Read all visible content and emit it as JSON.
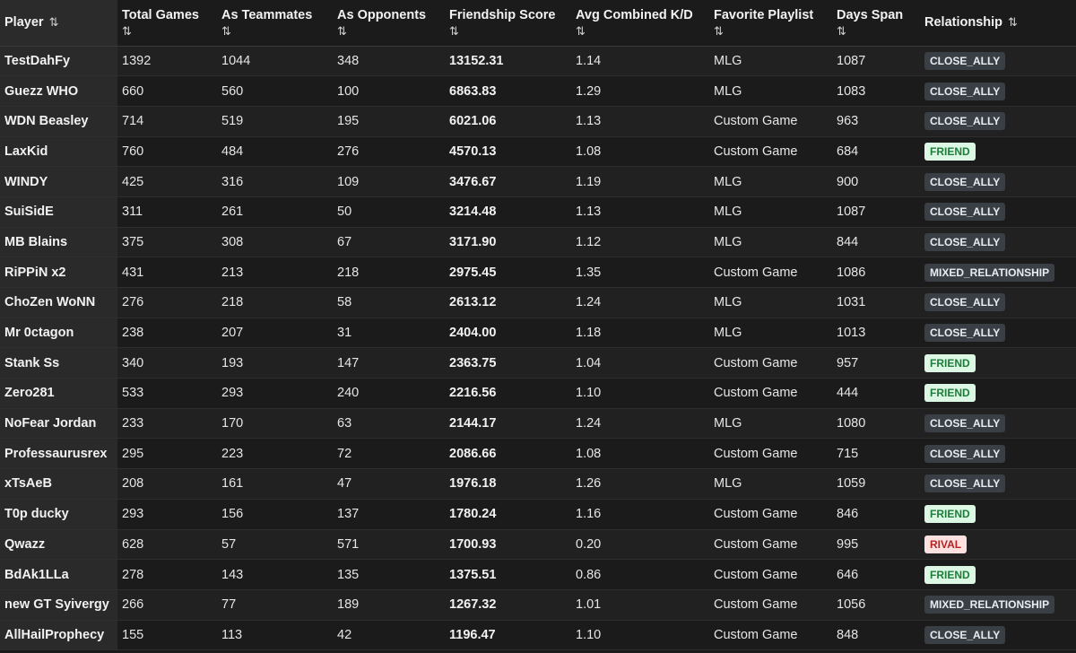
{
  "sort_icon": "⇅",
  "columns": [
    {
      "key": "player",
      "label": "Player"
    },
    {
      "key": "total",
      "label": "Total Games"
    },
    {
      "key": "teammates",
      "label": "As Teammates"
    },
    {
      "key": "opponents",
      "label": "As Opponents"
    },
    {
      "key": "score",
      "label": "Friendship Score"
    },
    {
      "key": "kd",
      "label": "Avg Combined K/D"
    },
    {
      "key": "playlist",
      "label": "Favorite Playlist"
    },
    {
      "key": "days",
      "label": "Days Span"
    },
    {
      "key": "relationship",
      "label": "Relationship"
    }
  ],
  "badge_colors": {
    "CLOSE_ALLY": "#3a3f45",
    "FRIEND": "#dcf7e3",
    "RIVAL": "#fde0e0",
    "MIXED_RELATIONSHIP": "#3a3f45"
  },
  "rows": [
    {
      "player": "TestDahFy",
      "total": "1392",
      "teammates": "1044",
      "opponents": "348",
      "score": "13152.31",
      "kd": "1.14",
      "playlist": "MLG",
      "days": "1087",
      "relationship": "CLOSE_ALLY"
    },
    {
      "player": "Guezz WHO",
      "total": "660",
      "teammates": "560",
      "opponents": "100",
      "score": "6863.83",
      "kd": "1.29",
      "playlist": "MLG",
      "days": "1083",
      "relationship": "CLOSE_ALLY"
    },
    {
      "player": "WDN Beasley",
      "total": "714",
      "teammates": "519",
      "opponents": "195",
      "score": "6021.06",
      "kd": "1.13",
      "playlist": "Custom Game",
      "days": "963",
      "relationship": "CLOSE_ALLY"
    },
    {
      "player": "LaxKid",
      "total": "760",
      "teammates": "484",
      "opponents": "276",
      "score": "4570.13",
      "kd": "1.08",
      "playlist": "Custom Game",
      "days": "684",
      "relationship": "FRIEND"
    },
    {
      "player": "WINDY",
      "total": "425",
      "teammates": "316",
      "opponents": "109",
      "score": "3476.67",
      "kd": "1.19",
      "playlist": "MLG",
      "days": "900",
      "relationship": "CLOSE_ALLY"
    },
    {
      "player": "SuiSidE",
      "total": "311",
      "teammates": "261",
      "opponents": "50",
      "score": "3214.48",
      "kd": "1.13",
      "playlist": "MLG",
      "days": "1087",
      "relationship": "CLOSE_ALLY"
    },
    {
      "player": "MB Blains",
      "total": "375",
      "teammates": "308",
      "opponents": "67",
      "score": "3171.90",
      "kd": "1.12",
      "playlist": "MLG",
      "days": "844",
      "relationship": "CLOSE_ALLY"
    },
    {
      "player": "RiPPiN x2",
      "total": "431",
      "teammates": "213",
      "opponents": "218",
      "score": "2975.45",
      "kd": "1.35",
      "playlist": "Custom Game",
      "days": "1086",
      "relationship": "MIXED_RELATIONSHIP"
    },
    {
      "player": "ChoZen WoNN",
      "total": "276",
      "teammates": "218",
      "opponents": "58",
      "score": "2613.12",
      "kd": "1.24",
      "playlist": "MLG",
      "days": "1031",
      "relationship": "CLOSE_ALLY"
    },
    {
      "player": "Mr 0ctagon",
      "total": "238",
      "teammates": "207",
      "opponents": "31",
      "score": "2404.00",
      "kd": "1.18",
      "playlist": "MLG",
      "days": "1013",
      "relationship": "CLOSE_ALLY"
    },
    {
      "player": "Stank Ss",
      "total": "340",
      "teammates": "193",
      "opponents": "147",
      "score": "2363.75",
      "kd": "1.04",
      "playlist": "Custom Game",
      "days": "957",
      "relationship": "FRIEND"
    },
    {
      "player": "Zero281",
      "total": "533",
      "teammates": "293",
      "opponents": "240",
      "score": "2216.56",
      "kd": "1.10",
      "playlist": "Custom Game",
      "days": "444",
      "relationship": "FRIEND"
    },
    {
      "player": "NoFear Jordan",
      "total": "233",
      "teammates": "170",
      "opponents": "63",
      "score": "2144.17",
      "kd": "1.24",
      "playlist": "MLG",
      "days": "1080",
      "relationship": "CLOSE_ALLY"
    },
    {
      "player": "Professaurusrex",
      "total": "295",
      "teammates": "223",
      "opponents": "72",
      "score": "2086.66",
      "kd": "1.08",
      "playlist": "Custom Game",
      "days": "715",
      "relationship": "CLOSE_ALLY"
    },
    {
      "player": "xTsAeB",
      "total": "208",
      "teammates": "161",
      "opponents": "47",
      "score": "1976.18",
      "kd": "1.26",
      "playlist": "MLG",
      "days": "1059",
      "relationship": "CLOSE_ALLY"
    },
    {
      "player": "T0p ducky",
      "total": "293",
      "teammates": "156",
      "opponents": "137",
      "score": "1780.24",
      "kd": "1.16",
      "playlist": "Custom Game",
      "days": "846",
      "relationship": "FRIEND"
    },
    {
      "player": "Qwazz",
      "total": "628",
      "teammates": "57",
      "opponents": "571",
      "score": "1700.93",
      "kd": "0.20",
      "playlist": "Custom Game",
      "days": "995",
      "relationship": "RIVAL"
    },
    {
      "player": "BdAk1LLa",
      "total": "278",
      "teammates": "143",
      "opponents": "135",
      "score": "1375.51",
      "kd": "0.86",
      "playlist": "Custom Game",
      "days": "646",
      "relationship": "FRIEND"
    },
    {
      "player": "new GT Syivergy",
      "total": "266",
      "teammates": "77",
      "opponents": "189",
      "score": "1267.32",
      "kd": "1.01",
      "playlist": "Custom Game",
      "days": "1056",
      "relationship": "MIXED_RELATIONSHIP"
    },
    {
      "player": "AllHailProphecy",
      "total": "155",
      "teammates": "113",
      "opponents": "42",
      "score": "1196.47",
      "kd": "1.10",
      "playlist": "Custom Game",
      "days": "848",
      "relationship": "CLOSE_ALLY"
    }
  ]
}
